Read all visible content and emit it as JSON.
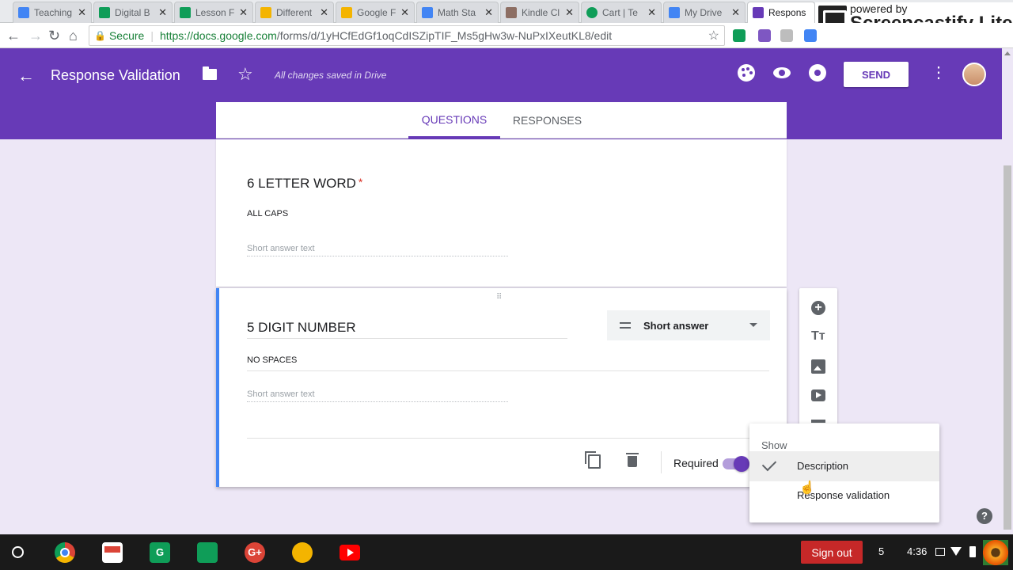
{
  "browser": {
    "tabs": [
      {
        "title": "Teaching",
        "color": "#4285f4"
      },
      {
        "title": "Digital B",
        "color": "#0f9d58"
      },
      {
        "title": "Lesson F",
        "color": "#0f9d58"
      },
      {
        "title": "Different",
        "color": "#f4b400"
      },
      {
        "title": "Google F",
        "color": "#f4b400"
      },
      {
        "title": "Math Sta",
        "color": "#4285f4"
      },
      {
        "title": "Kindle Cl",
        "color": "#8d6e63"
      },
      {
        "title": "Cart | Te",
        "color": "#0f9d58"
      },
      {
        "title": "My Drive",
        "color": "#4285f4"
      },
      {
        "title": "Respons",
        "color": "#673ab7"
      }
    ],
    "secure_label": "Secure",
    "url_host": "https://docs.google.com",
    "url_path": "/forms/d/1yHCfEdGf1oqCdISZipTIF_Ms5gHw3w-NuPxIXeutKL8/edit"
  },
  "watermark": {
    "powered_by": "powered by",
    "name": "Screencastify Lite"
  },
  "form_header": {
    "title": "Response Validation",
    "saved_status": "All changes saved in Drive",
    "send_label": "SEND",
    "accent_color": "#673ab7"
  },
  "form_tabs": {
    "questions": "QUESTIONS",
    "responses": "RESPONSES"
  },
  "question1": {
    "title": "6 LETTER WORD",
    "required_mark": "*",
    "description": "ALL CAPS",
    "answer_placeholder": "Short answer text"
  },
  "question2": {
    "drag_handle": "⠿",
    "title": "5 DIGIT NUMBER",
    "description": "NO SPACES",
    "answer_placeholder": "Short answer text",
    "type": "Short answer",
    "required_label": "Required",
    "required": true
  },
  "show_menu": {
    "header": "Show",
    "items": [
      {
        "label": "Description",
        "checked": true
      },
      {
        "label": "Response validation",
        "checked": false
      }
    ]
  },
  "help_label": "?",
  "taskbar": {
    "signout_label": "Sign out",
    "notification_count": "5",
    "time": "4:36"
  }
}
